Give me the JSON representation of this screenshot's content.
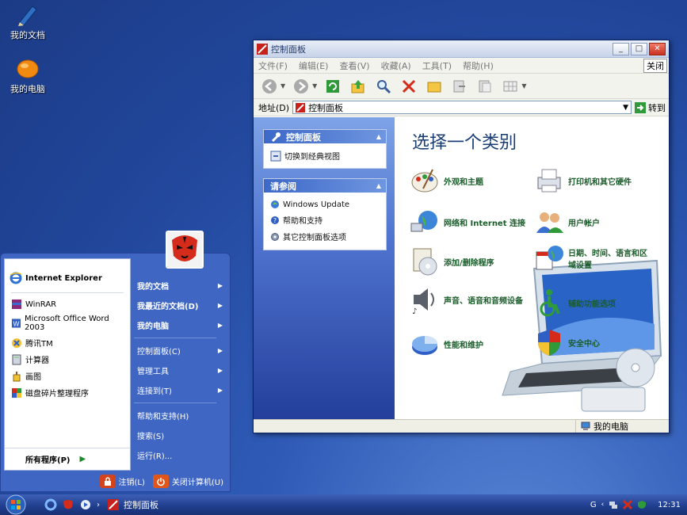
{
  "desktop": {
    "icons": [
      {
        "label": "我的文档"
      },
      {
        "label": "我的电脑"
      }
    ]
  },
  "window": {
    "title": "控制面板",
    "menu": [
      "文件(F)",
      "编辑(E)",
      "查看(V)",
      "收藏(A)",
      "工具(T)",
      "帮助(H)"
    ],
    "close_label": "关闭",
    "address_label": "地址(D)",
    "address_value": "控制面板",
    "go_label": "转到",
    "taskpane": {
      "panel_title": "控制面板",
      "switch_label": "切换到经典视图",
      "see_also_title": "请参阅",
      "see_also": [
        "Windows Update",
        "帮助和支持",
        "其它控制面板选项"
      ]
    },
    "main_title": "选择一个类别",
    "categories": [
      "外观和主题",
      "打印机和其它硬件",
      "网络和 Internet 连接",
      "用户帐户",
      "添加/删除程序",
      "日期、时间、语言和区域设置",
      "声音、语音和音频设备",
      "辅助功能选项",
      "性能和维护",
      "安全中心"
    ],
    "status_text": "我的电脑"
  },
  "start_menu": {
    "pinned": "Internet Explorer",
    "recent": [
      "WinRAR",
      "Microsoft Office Word 2003",
      "腾讯TM",
      "计算器",
      "画图",
      "磁盘碎片整理程序"
    ],
    "all_programs": "所有程序(P)",
    "right": {
      "my_docs": "我的文档",
      "recent_docs": "我最近的文档(D)",
      "my_computer": "我的电脑",
      "control_panel": "控制面板(C)",
      "admin_tools": "管理工具",
      "connect_to": "连接到(T)",
      "help": "帮助和支持(H)",
      "search": "搜索(S)",
      "run": "运行(R)..."
    },
    "logoff": "注销(L)",
    "shutdown": "关闭计算机(U)"
  },
  "taskbar": {
    "task_label": "控制面板",
    "tray_letter": "G",
    "clock": "12:31"
  }
}
